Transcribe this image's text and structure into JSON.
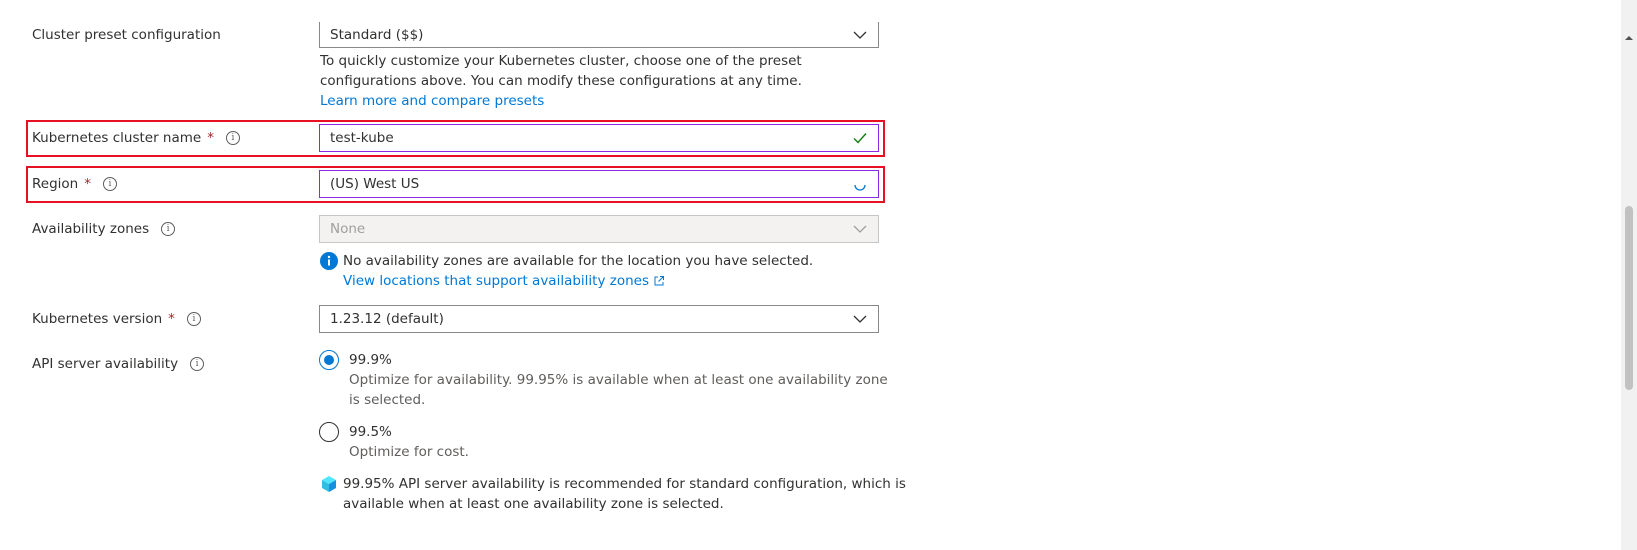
{
  "preset": {
    "label": "Cluster preset configuration",
    "value": "Standard ($$)",
    "help_line1": "To quickly customize your Kubernetes cluster, choose one of the preset",
    "help_line2": "configurations above. You can modify these configurations at any time.",
    "link": "Learn more and compare presets"
  },
  "cluster_name": {
    "label": "Kubernetes cluster name",
    "required_mark": "*",
    "value": "test-kube"
  },
  "region": {
    "label": "Region",
    "required_mark": "*",
    "value": "(US) West US"
  },
  "availability_zones": {
    "label": "Availability zones",
    "value": "None",
    "info": "No availability zones are available for the location you have selected.",
    "link": "View locations that support availability zones"
  },
  "k8s_version": {
    "label": "Kubernetes version",
    "required_mark": "*",
    "value": "1.23.12 (default)"
  },
  "api_server": {
    "label": "API server availability",
    "options": [
      {
        "value": "99.9%",
        "desc_line1": "Optimize for availability. 99.95% is available when at least one availability zone",
        "desc_line2": "is selected.",
        "checked": true
      },
      {
        "value": "99.5%",
        "desc_line1": "Optimize for cost.",
        "desc_line2": "",
        "checked": false
      }
    ],
    "note_line1": "99.95% API server availability is recommended for standard configuration, which is",
    "note_line2": "available when at least one availability zone is selected."
  },
  "colors": {
    "accent": "#0078d4",
    "highlight": "#e81123",
    "required": "#a4262c",
    "valid_check": "#107c10"
  },
  "icons": {
    "info": "info-circle-icon",
    "check": "checkmark-icon",
    "spinner": "loading-spinner-icon",
    "external": "external-link-icon",
    "cube": "cube-icon",
    "chevron": "chevron-down-icon"
  }
}
